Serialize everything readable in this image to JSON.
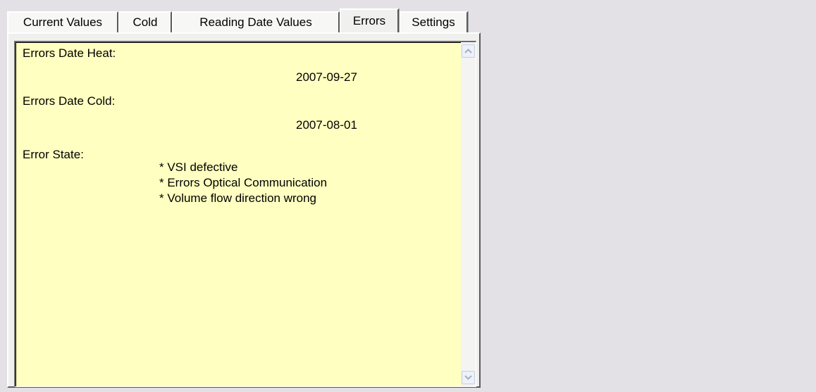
{
  "tabs": [
    {
      "label": "Current Values",
      "active": false
    },
    {
      "label": "Cold",
      "active": false
    },
    {
      "label": "Reading Date Values",
      "active": false
    },
    {
      "label": "Errors",
      "active": true
    },
    {
      "label": "Settings",
      "active": false
    }
  ],
  "errors": {
    "heat_label": "Errors Date Heat:",
    "heat_date": "2007-09-27",
    "cold_label": "Errors Date Cold:",
    "cold_date": "2007-08-01",
    "state_label": "Error State:",
    "state_items": [
      "* VSI defective",
      "* Errors Optical Communication",
      "* Volume flow direction wrong"
    ]
  },
  "colors": {
    "textarea_bg": "#ffffc1",
    "window_bg": "#e3e1e6"
  },
  "icons": {
    "scroll_up": "scroll-up-arrow-icon",
    "scroll_down": "scroll-down-arrow-icon"
  }
}
